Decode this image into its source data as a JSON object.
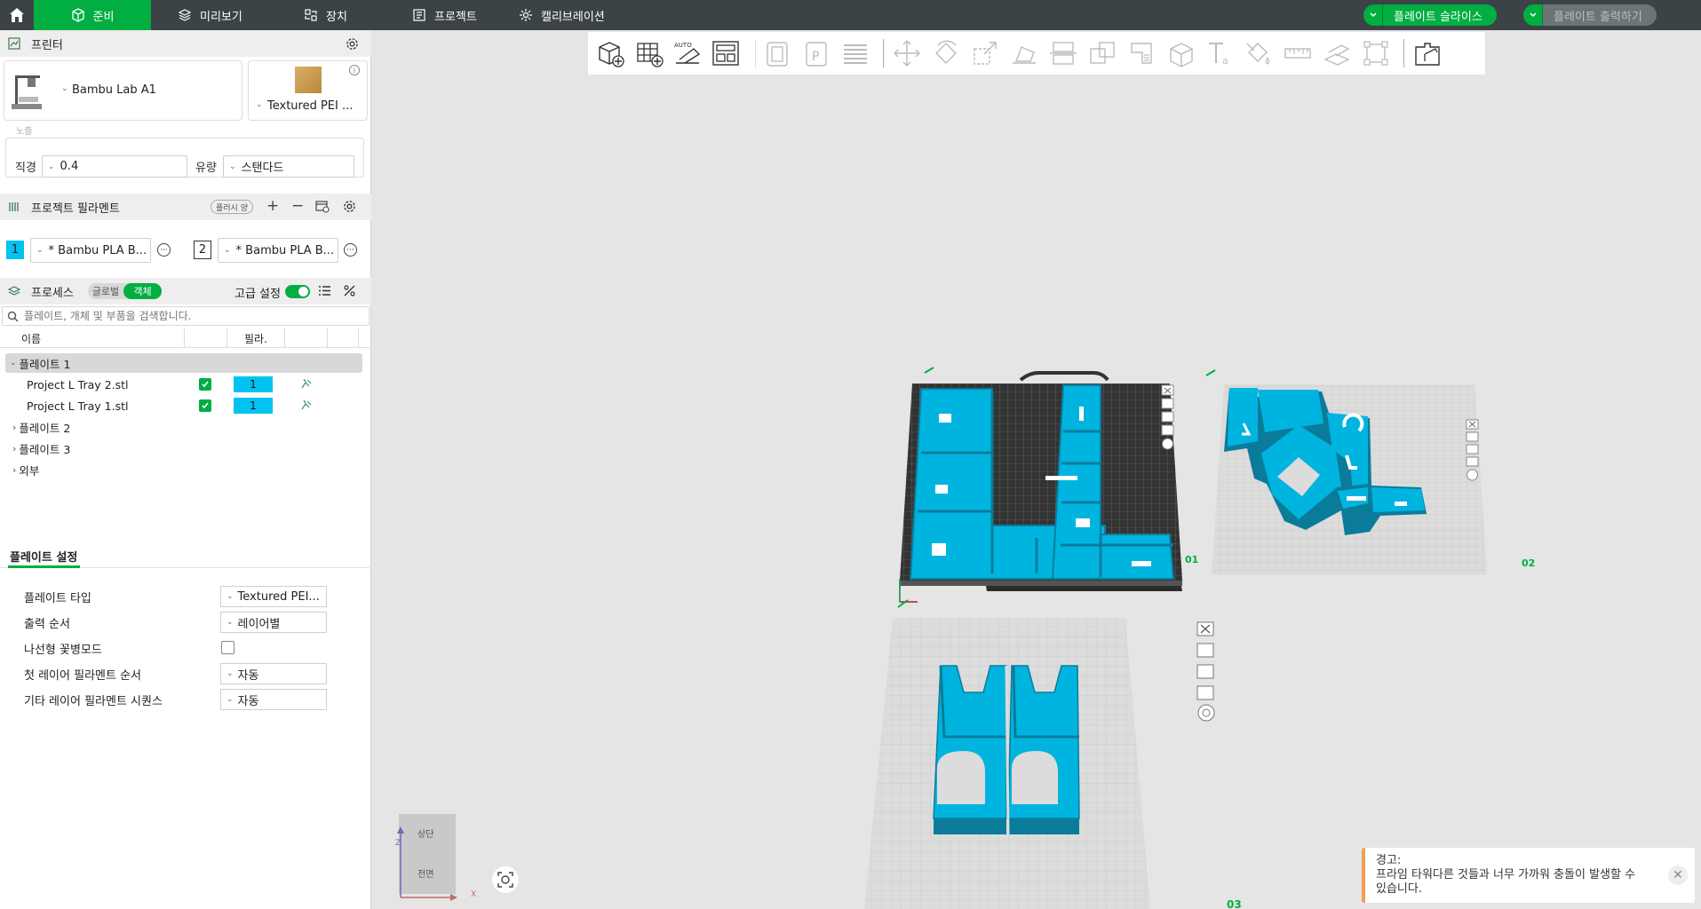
{
  "topbar": {
    "tabs": [
      {
        "label": "준비",
        "icon": "cube-icon"
      },
      {
        "label": "미리보기",
        "icon": "layers-icon"
      },
      {
        "label": "장치",
        "icon": "device-icon"
      },
      {
        "label": "프로젝트",
        "icon": "project-icon"
      },
      {
        "label": "캘리브레이션",
        "icon": "calibration-icon"
      }
    ],
    "slice_label": "플레이트 슬라이스",
    "print_label": "플레이트 출력하기"
  },
  "printer": {
    "section_title": "프린터",
    "name": "Bambu Lab A1",
    "plate_type": "Textured PEI ...",
    "nozzle_caption": "노즐",
    "diameter_label": "직경",
    "diameter_value": "0.4",
    "flow_label": "유량",
    "flow_value": "스탠다드"
  },
  "filament": {
    "section_title": "프로젝트 필라멘트",
    "flush_label": "플러시 양",
    "slots": [
      {
        "index": "1",
        "name": "* Bambu PLA B...",
        "color": "#00c3f0"
      },
      {
        "index": "2",
        "name": "* Bambu PLA B...",
        "color": "#ffffff"
      }
    ]
  },
  "process": {
    "section_title": "프로세스",
    "toggle_global": "글로벌",
    "toggle_object": "객체",
    "advanced_label": "고급 설정",
    "search_placeholder": "플레이트, 개체 및 부품을 검색합니다.",
    "col_name": "이름",
    "col_filament": "필라.",
    "tree": {
      "plate1": "플레이트 1",
      "items": [
        {
          "name": "Project L Tray 2.stl",
          "filament": "1"
        },
        {
          "name": "Project L Tray 1.stl",
          "filament": "1"
        }
      ],
      "plate2": "플레이트 2",
      "plate3": "플레이트 3",
      "outside": "외부"
    }
  },
  "plate_settings": {
    "tab_label": "플레이트 설정",
    "rows": [
      {
        "label": "플레이트 타입",
        "value": "Textured PEI..."
      },
      {
        "label": "출력 순서",
        "value": "레이어별"
      },
      {
        "label": "나선형 꽃병모드",
        "value": ""
      },
      {
        "label": "첫 레이어 필라멘트 순서",
        "value": "자동"
      },
      {
        "label": "기타 레이어 필라멘트 시퀀스",
        "value": "자동"
      }
    ]
  },
  "viewport": {
    "plate_numbers": [
      "01",
      "02",
      "03"
    ],
    "view_cube_top": "상단",
    "view_cube_front": "전면",
    "axis_z": "Z",
    "axis_x": "X"
  },
  "warning": {
    "title": "경고:",
    "message": "프라임 타워다른 것들과 너무 가까워 충돌이 발생할 수 있습니다."
  },
  "colors": {
    "accent": "#00ae42",
    "model": "#00b4e0",
    "model_dark": "#0a7c9a",
    "topbar": "#3b4346"
  }
}
